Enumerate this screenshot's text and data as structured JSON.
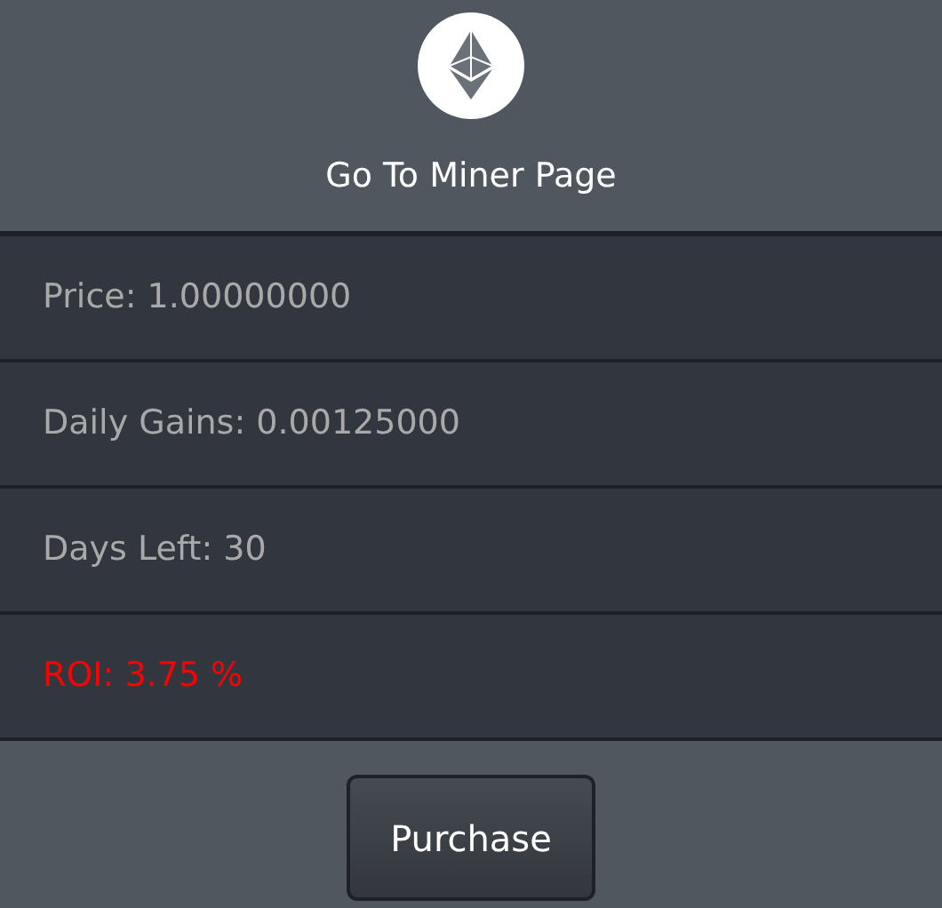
{
  "header": {
    "link": "Go To Miner Page"
  },
  "stats": [
    {
      "text": "Price: 1.00000000",
      "color": "#a9a9a9"
    },
    {
      "text": "Daily Gains: 0.00125000",
      "color": "#a9a9a9"
    },
    {
      "text": "Days Left: 30",
      "color": "#a9a9a9"
    },
    {
      "text": "ROI: 3.75 %",
      "color": "#ff0000"
    }
  ],
  "button": "Purchase"
}
